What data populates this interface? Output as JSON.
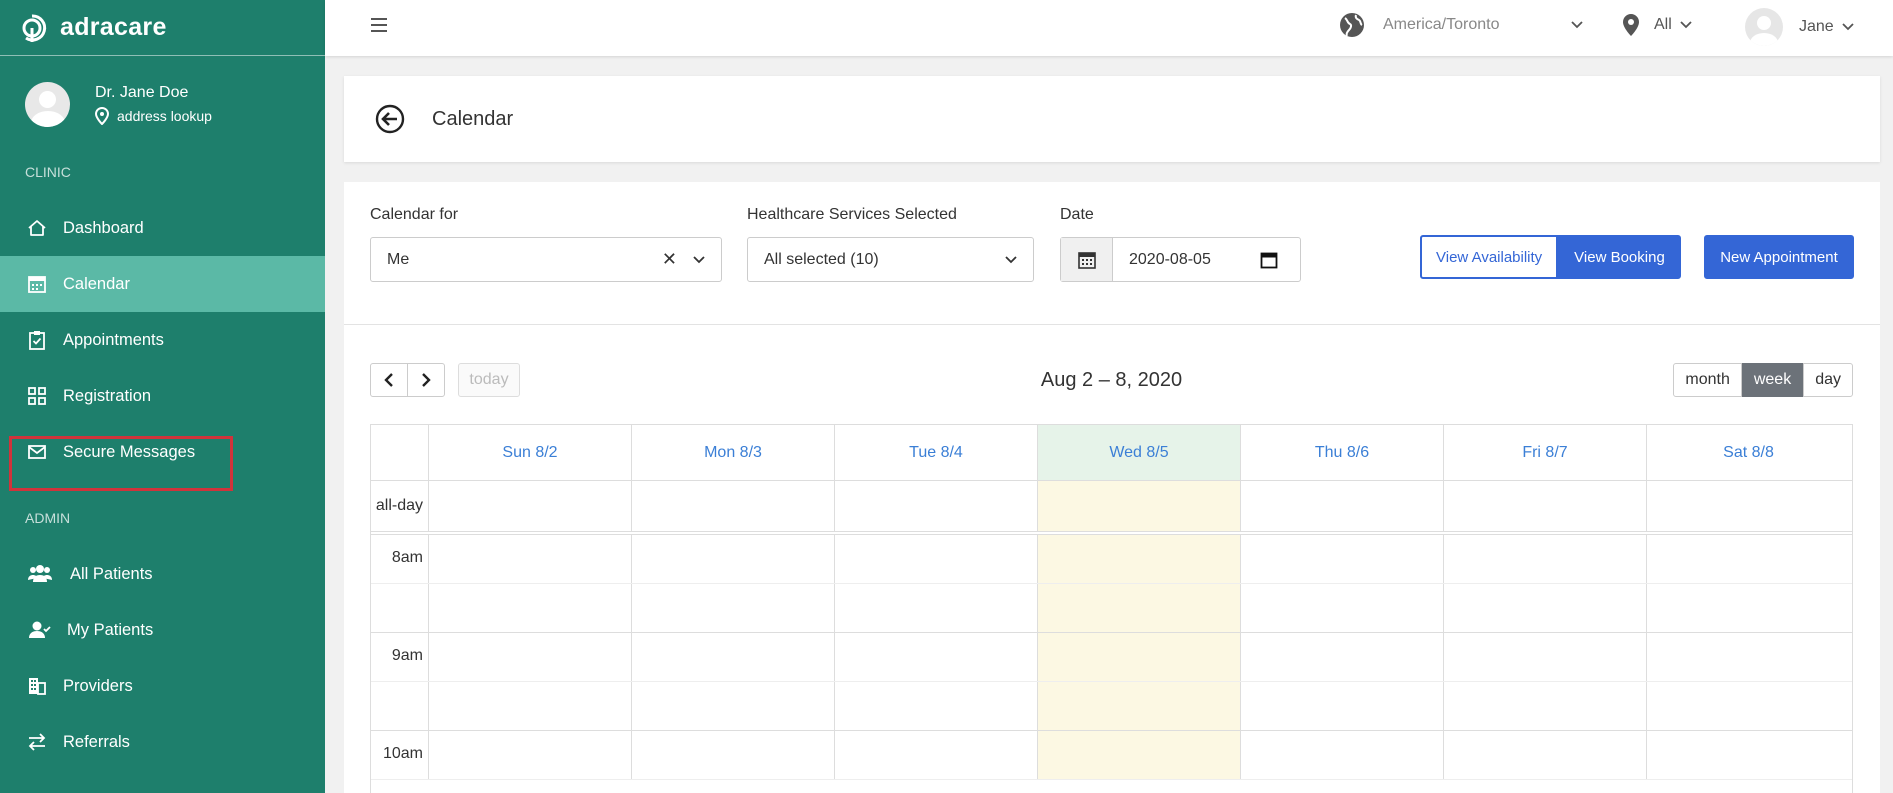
{
  "brand": {
    "name": "adracare"
  },
  "user": {
    "name": "Dr. Jane Doe",
    "address": "address lookup"
  },
  "sidebar": {
    "clinic_label": "CLINIC",
    "admin_label": "ADMIN",
    "clinic_items": [
      {
        "label": "Dashboard",
        "icon": "home-icon"
      },
      {
        "label": "Calendar",
        "icon": "calendar-icon",
        "active": true
      },
      {
        "label": "Appointments",
        "icon": "clipboard-check-icon"
      },
      {
        "label": "Registration",
        "icon": "grid-icon"
      },
      {
        "label": "Secure Messages",
        "icon": "envelope-icon"
      }
    ],
    "admin_items": [
      {
        "label": "All Patients",
        "icon": "users-icon"
      },
      {
        "label": "My Patients",
        "icon": "user-icon"
      },
      {
        "label": "Providers",
        "icon": "building-icon"
      },
      {
        "label": "Referrals",
        "icon": "exchange-icon"
      }
    ]
  },
  "topbar": {
    "timezone": "America/Toronto",
    "location": "All",
    "username": "Jane"
  },
  "page": {
    "title": "Calendar"
  },
  "filters": {
    "calendar_for_label": "Calendar for",
    "calendar_for_value": "Me",
    "clear_symbol": "✕",
    "services_label": "Healthcare Services Selected",
    "services_value": "All selected (10)",
    "date_label": "Date",
    "date_value": "2020-08-05"
  },
  "buttons": {
    "view_availability": "View Availability",
    "view_booking": "View Booking",
    "new_appointment": "New Appointment"
  },
  "calendar": {
    "today_label": "today",
    "range_title": "Aug 2 – 8, 2020",
    "views": [
      "month",
      "week",
      "day"
    ],
    "active_view": "week",
    "days": [
      "Sun 8/2",
      "Mon 8/3",
      "Tue 8/4",
      "Wed 8/5",
      "Thu 8/6",
      "Fri 8/7",
      "Sat 8/8"
    ],
    "today_index": 3,
    "allday_label": "all-day",
    "hours": [
      "8am",
      "9am",
      "10am"
    ]
  },
  "colors": {
    "sidebar_bg": "#1e7f6c",
    "sidebar_active": "#5bb9a6",
    "primary_button": "#3466d6",
    "day_header_text": "#3b7fd6",
    "today_column": "#fcf8e3",
    "highlight_border": "#d0333b"
  }
}
